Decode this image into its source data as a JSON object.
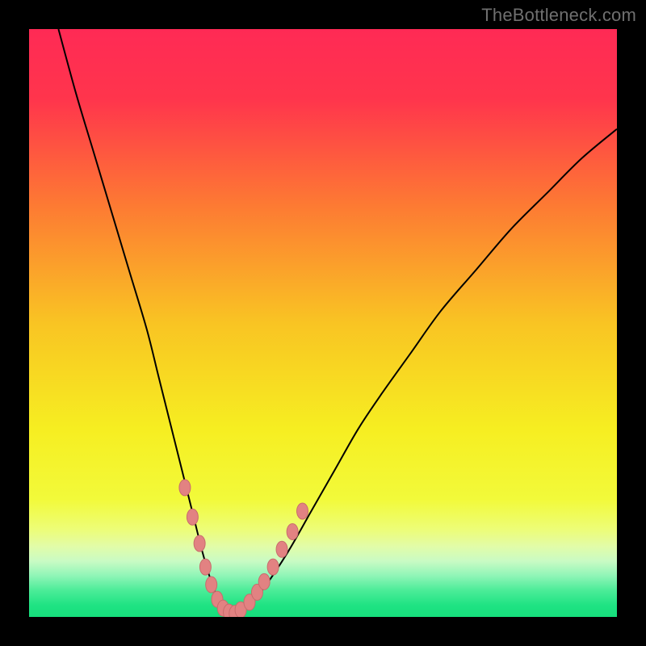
{
  "watermark": "TheBottleneck.com",
  "colors": {
    "page_background": "#000000",
    "curve_stroke": "#000000",
    "marker_fill": "#E28282",
    "marker_stroke": "#C86C6C",
    "gradient_stops": [
      {
        "offset": 0.0,
        "color": "#FF2A55"
      },
      {
        "offset": 0.12,
        "color": "#FF354C"
      },
      {
        "offset": 0.3,
        "color": "#FD7A33"
      },
      {
        "offset": 0.5,
        "color": "#F9C423"
      },
      {
        "offset": 0.68,
        "color": "#F6EE21"
      },
      {
        "offset": 0.8,
        "color": "#F2FA3A"
      },
      {
        "offset": 0.85,
        "color": "#EDFD76"
      },
      {
        "offset": 0.88,
        "color": "#E2FCA8"
      },
      {
        "offset": 0.905,
        "color": "#C9FBC4"
      },
      {
        "offset": 0.93,
        "color": "#8FF5B7"
      },
      {
        "offset": 0.955,
        "color": "#4BEC98"
      },
      {
        "offset": 0.98,
        "color": "#1FE383"
      },
      {
        "offset": 1.0,
        "color": "#16DE7C"
      }
    ]
  },
  "chart_data": {
    "type": "line",
    "title": "",
    "xlabel": "",
    "ylabel": "",
    "xlim": [
      0,
      100
    ],
    "ylim": [
      0,
      100
    ],
    "series": [
      {
        "name": "bottleneck-curve",
        "x": [
          5,
          8,
          11,
          14,
          17,
          20,
          22,
          24,
          26,
          28,
          29.5,
          31,
          32.5,
          34,
          35.5,
          37,
          40,
          44,
          48,
          52,
          56,
          60,
          65,
          70,
          76,
          82,
          88,
          94,
          100
        ],
        "y": [
          100,
          89,
          79,
          69,
          59,
          49,
          41,
          33,
          25,
          17,
          11,
          6,
          2.5,
          0.8,
          0.5,
          1.5,
          5,
          11,
          18,
          25,
          32,
          38,
          45,
          52,
          59,
          66,
          72,
          78,
          83
        ]
      }
    ],
    "markers": {
      "name": "highlighted-points",
      "x": [
        26.5,
        27.8,
        29.0,
        30.0,
        31.0,
        32.0,
        33.0,
        34.0,
        35.0,
        36.0,
        37.5,
        38.8,
        40.0,
        41.5,
        43.0,
        44.8,
        46.5
      ],
      "y": [
        22.0,
        17.0,
        12.5,
        8.5,
        5.5,
        3.0,
        1.5,
        0.8,
        0.6,
        1.2,
        2.5,
        4.2,
        6.0,
        8.5,
        11.5,
        14.5,
        18.0
      ]
    }
  }
}
